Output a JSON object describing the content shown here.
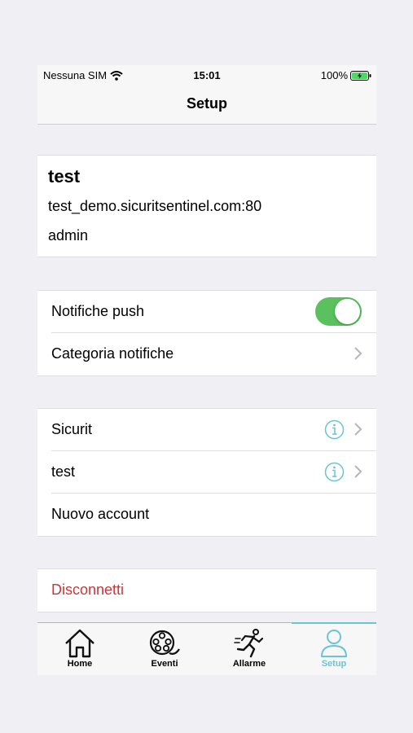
{
  "status": {
    "carrier": "Nessuna SIM",
    "time": "15:01",
    "battery": "100%"
  },
  "nav": {
    "title": "Setup"
  },
  "account": {
    "name": "test",
    "host": "test_demo.sicuritsentinel.com:80",
    "user": "admin"
  },
  "notifications": {
    "push_label": "Notifiche push",
    "push_enabled": true,
    "category_label": "Categoria notifiche"
  },
  "accounts": {
    "items": [
      {
        "label": "Sicurit"
      },
      {
        "label": "test"
      }
    ],
    "new_label": "Nuovo account"
  },
  "disconnect": {
    "label": "Disconnetti"
  },
  "tabs": [
    {
      "label": "Home",
      "icon": "home-icon"
    },
    {
      "label": "Eventi",
      "icon": "film-reel-icon"
    },
    {
      "label": "Allarme",
      "icon": "running-man-icon"
    },
    {
      "label": "Setup",
      "icon": "person-icon"
    }
  ],
  "colors": {
    "accent": "#69c4d4",
    "toggle_on": "#5ac15e",
    "danger": "#c8373a",
    "background": "#efeff4"
  }
}
